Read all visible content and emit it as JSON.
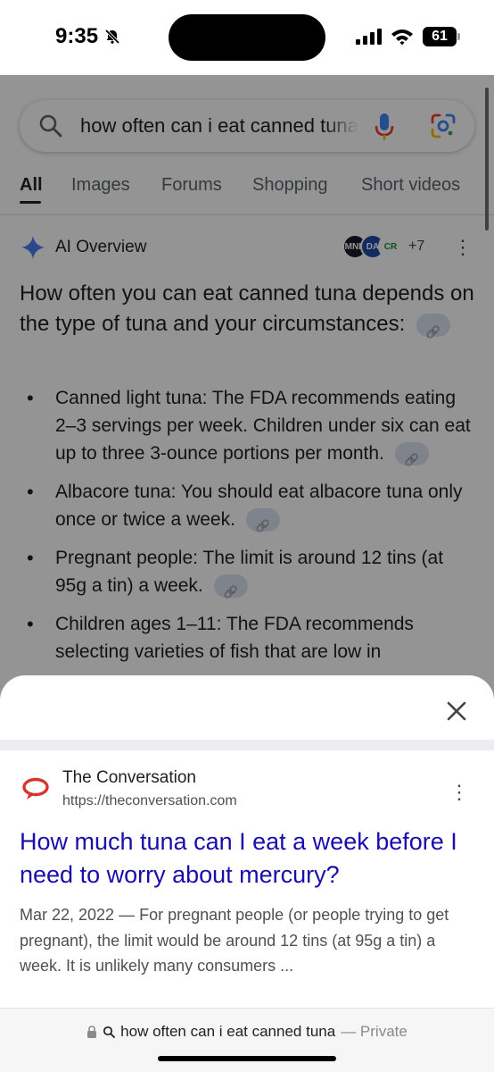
{
  "status_bar": {
    "time": "9:35",
    "battery": "61"
  },
  "search": {
    "query": "how often can i eat canned tuna"
  },
  "tabs": [
    {
      "label": "All",
      "active": true
    },
    {
      "label": "Images",
      "active": false
    },
    {
      "label": "Forums",
      "active": false
    },
    {
      "label": "Shopping",
      "active": false
    },
    {
      "label": "Short videos",
      "active": false
    }
  ],
  "ai_overview": {
    "title": "AI Overview",
    "sources": [
      {
        "label": "MNN",
        "bg": "#1b1b2b",
        "fg": "#ffffff"
      },
      {
        "label": "DA",
        "bg": "#1f4aa8",
        "fg": "#ffffff"
      },
      {
        "label": "CR",
        "bg": "#ffffff",
        "fg": "#1a8a3a"
      }
    ],
    "more_sources": "+7",
    "intro": "How often you can eat canned tuna depends on the type of tuna and your circumstances:",
    "items": [
      "Canned light tuna: The FDA recommends eating 2–3 servings per week. Children under six can eat up to three 3-ounce portions per month.",
      "Albacore tuna: You should eat albacore tuna only once or twice a week.",
      "Pregnant people: The limit is around 12 tins (at 95g a tin) a week.",
      "Children ages 1–11: The FDA recommends selecting varieties of fish that are low in"
    ]
  },
  "result": {
    "site_name": "The Conversation",
    "url": "https://theconversation.com",
    "title": "How much tuna can I eat a week before I need to worry about mercury?",
    "snippet": "Mar 22, 2022 — For pregnant people (or people trying to get pregnant), the limit would be around 12 tins (at 95g a tin) a week. It is unlikely many consumers ..."
  },
  "address_bar": {
    "text": "how often can i eat canned tuna",
    "mode": "— Private"
  },
  "colors": {
    "link": "#1a0dab",
    "favicon": "#d8352a",
    "scrim": "rgba(0,0,0,0.42)"
  }
}
